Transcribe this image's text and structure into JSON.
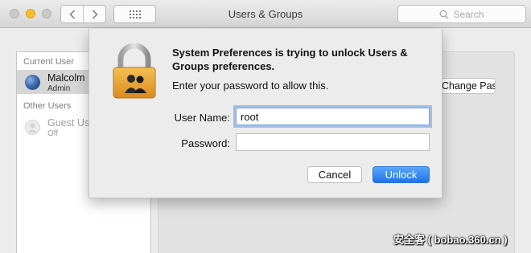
{
  "window": {
    "title": "Users & Groups"
  },
  "toolbar": {
    "back_icon": "chevron-left-icon",
    "forward_icon": "chevron-right-icon",
    "grid_icon": "grid-icon",
    "search_placeholder": "Search"
  },
  "sidebar": {
    "current_user_heading": "Current User",
    "current_user": {
      "name": "Malcolm",
      "role": "Admin"
    },
    "other_users_heading": "Other Users",
    "other_users": [
      {
        "name": "Guest User",
        "role": "Off"
      }
    ]
  },
  "background": {
    "change_password_button": "Change Password..."
  },
  "dialog": {
    "title": "System Preferences is trying to unlock Users & Groups preferences.",
    "message": "Enter your password to allow this.",
    "username_label": "User Name:",
    "username_value": "root",
    "password_label": "Password:",
    "password_value": "",
    "cancel_label": "Cancel",
    "unlock_label": "Unlock",
    "lock_icon": "padlock-users-icon"
  },
  "colors": {
    "accent": "#1f73e8",
    "focus_ring": "#649be6",
    "lock_gold": "#e8a23a"
  },
  "watermark": "安全客 ( bobao.360.cn )"
}
